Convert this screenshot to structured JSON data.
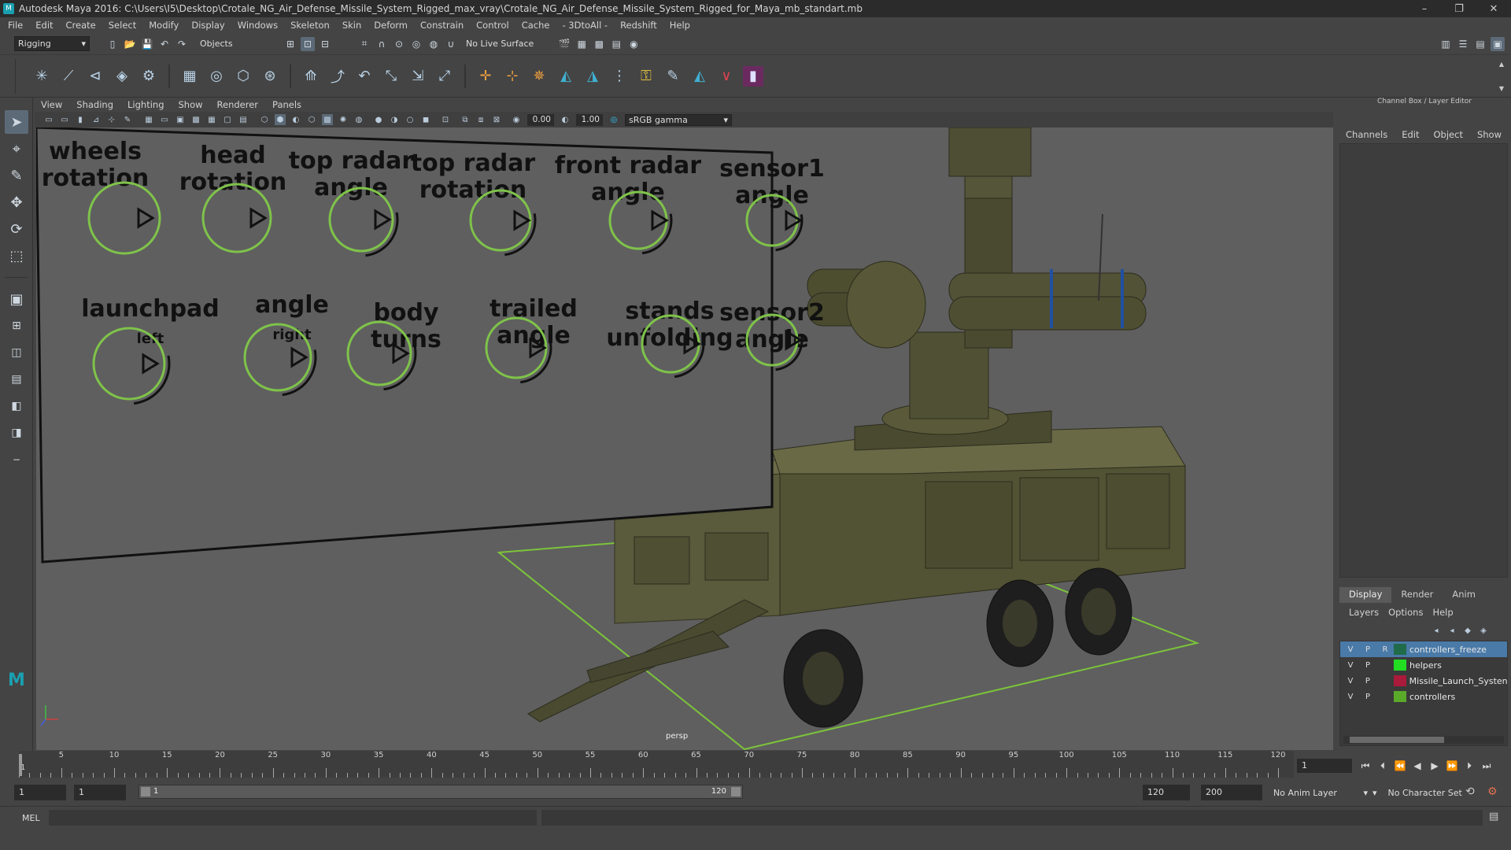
{
  "title_bar": {
    "title": "Autodesk Maya 2016: C:\\Users\\I5\\Desktop\\Crotale_NG_Air_Defense_Missile_System_Rigged_max_vray\\Crotale_NG_Air_Defense_Missile_System_Rigged_for_Maya_mb_standart.mb",
    "minimize": "–",
    "maximize": "❐",
    "close": "✕"
  },
  "menubar": [
    "File",
    "Edit",
    "Create",
    "Select",
    "Modify",
    "Display",
    "Windows",
    "Skeleton",
    "Skin",
    "Deform",
    "Constrain",
    "Control",
    "Cache",
    "- 3DtoAll -",
    "Redshift",
    "Help"
  ],
  "status_line": {
    "menuset": "Rigging",
    "selection_mode": "Objects",
    "live_surface": "No Live Surface"
  },
  "viewport": {
    "menu": [
      "View",
      "Shading",
      "Lighting",
      "Show",
      "Renderer",
      "Panels"
    ],
    "exposure": "0.00",
    "gamma": "1.00",
    "color_space": "sRGB gamma",
    "camera_label": "persp",
    "controller_labels": [
      {
        "line1": "wheels",
        "line2": "rotation",
        "sub": ""
      },
      {
        "line1": "head",
        "line2": "rotation",
        "sub": ""
      },
      {
        "line1": "top radar",
        "line2": "angle",
        "sub": ""
      },
      {
        "line1": "top radar",
        "line2": "rotation",
        "sub": ""
      },
      {
        "line1": "front radar",
        "line2": "angle",
        "sub": ""
      },
      {
        "line1": "sensor1",
        "line2": "angle",
        "sub": ""
      },
      {
        "line1": "launchpad",
        "line2": "",
        "sub": "left"
      },
      {
        "line1": "angle",
        "line2": "",
        "sub": "right"
      },
      {
        "line1": "body",
        "line2": "turns",
        "sub": ""
      },
      {
        "line1": "trailed",
        "line2": "angle",
        "sub": ""
      },
      {
        "line1": "stands",
        "line2": "unfolding",
        "sub": ""
      },
      {
        "line1": "sensor2",
        "line2": "angle",
        "sub": ""
      }
    ],
    "controller_color": "#7fc34a",
    "ground_grid_color": "#7cc43a",
    "vehicle_color": "#4a4a30"
  },
  "channel_box": {
    "header": "Channel Box / Layer Editor",
    "tabs": [
      "Channels",
      "Edit",
      "Object",
      "Show"
    ]
  },
  "layer_editor": {
    "tabs": [
      "Display",
      "Render",
      "Anim"
    ],
    "active_tab": "Display",
    "menu": [
      "Layers",
      "Options",
      "Help"
    ],
    "layers": [
      {
        "v": "V",
        "p": "P",
        "r": "R",
        "name": "controllers_freeze",
        "color": "#1f6b4a",
        "selected": true
      },
      {
        "v": "V",
        "p": "P",
        "r": "",
        "name": "helpers",
        "color": "#22dd22",
        "selected": false
      },
      {
        "v": "V",
        "p": "P",
        "r": "",
        "name": "Missile_Launch_Systen",
        "color": "#aa1a3a",
        "selected": false
      },
      {
        "v": "V",
        "p": "P",
        "r": "",
        "name": "controllers",
        "color": "#5aaa2a",
        "selected": false
      }
    ]
  },
  "time_slider": {
    "ticks": [
      "5",
      "10",
      "15",
      "20",
      "25",
      "30",
      "35",
      "40",
      "45",
      "50",
      "55",
      "60",
      "65",
      "70",
      "75",
      "80",
      "85",
      "90",
      "95",
      "100",
      "105",
      "110",
      "115",
      "120"
    ],
    "start_label": "1",
    "current_frame": "1"
  },
  "range_slider": {
    "start": "1",
    "playback_start": "1",
    "range_start_label": "1",
    "range_end_label": "120",
    "playback_end": "120",
    "end": "200",
    "anim_layer": "No Anim Layer",
    "character_set": "No Character Set"
  },
  "command_line": {
    "label": "MEL"
  }
}
